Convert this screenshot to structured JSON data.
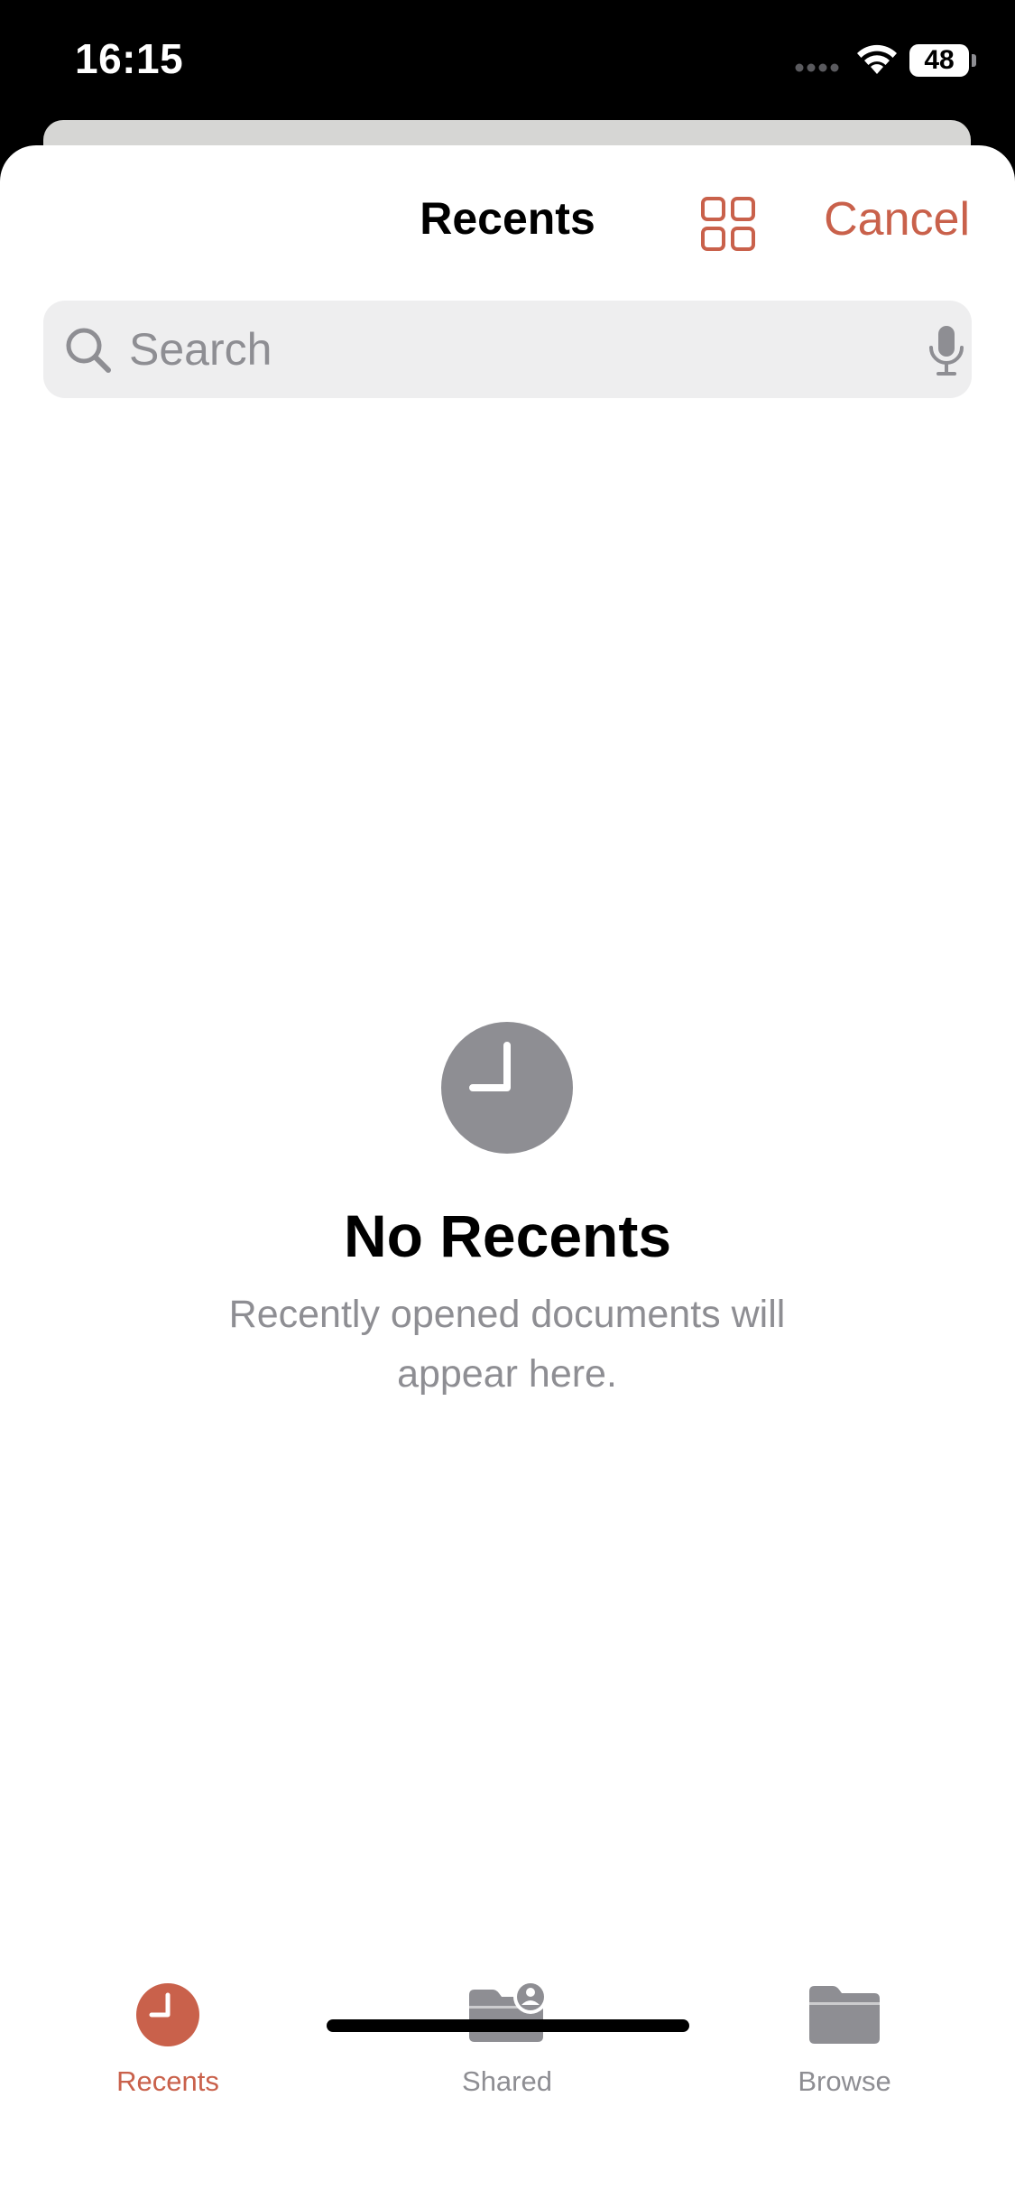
{
  "status_bar": {
    "time": "16:15",
    "battery": "48"
  },
  "header": {
    "title": "Recents",
    "grid_icon": "grid-view-icon",
    "cancel_label": "Cancel"
  },
  "search": {
    "placeholder": "Search",
    "value": "",
    "icon": "magnifying-glass-icon",
    "mic_icon": "microphone-icon"
  },
  "empty_state": {
    "icon": "clock-icon",
    "title": "No Recents",
    "message": "Recently opened documents will appear here."
  },
  "tabs": [
    {
      "label": "Recents",
      "icon": "clock-icon",
      "selected": true
    },
    {
      "label": "Shared",
      "icon": "shared-folder-icon",
      "selected": false
    },
    {
      "label": "Browse",
      "icon": "folder-icon",
      "selected": false
    }
  ],
  "colors": {
    "accent": "#c9614b",
    "inactive": "#8e8e93",
    "search_background": "#eeeeef"
  }
}
